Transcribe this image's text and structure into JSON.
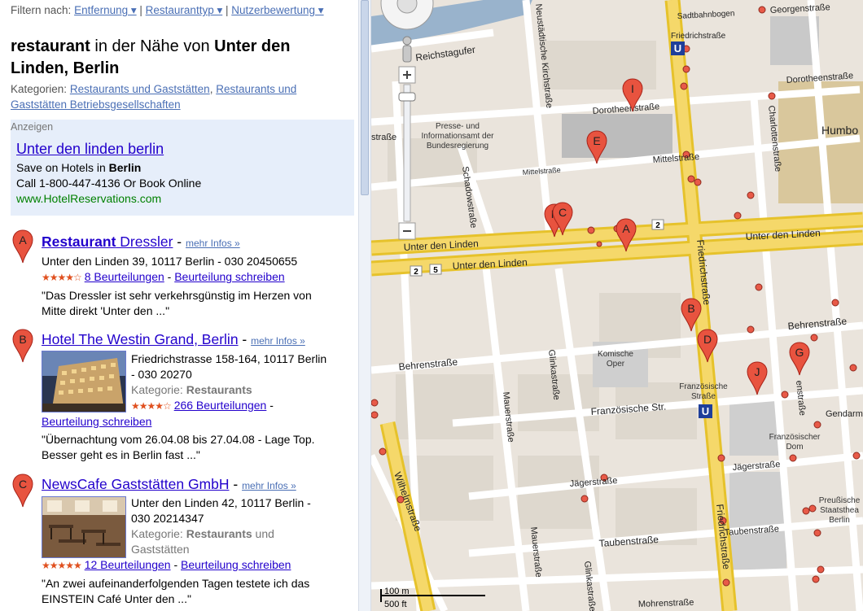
{
  "filter": {
    "label": "Filtern nach:",
    "items": [
      "Entfernung ▾",
      "Restauranttyp ▾",
      "Nutzerbewertung ▾"
    ]
  },
  "heading": {
    "term": "restaurant",
    "middle": " in der Nähe von ",
    "place": "Unter den Linden, Berlin"
  },
  "categories": {
    "label": "Kategorien:",
    "items": [
      "Restaurants und Gaststätten",
      "Restaurants und Gaststätten Betriebsgesellschaften"
    ]
  },
  "ads": {
    "label": "Anzeigen",
    "title": "Unter den linden berlin",
    "line1_prefix": "Save on Hotels in ",
    "line1_bold": "Berlin",
    "line2": "Call 1-800-447-4136 Or Book Online",
    "url": "www.HotelReservations.com"
  },
  "results": [
    {
      "letter": "A",
      "title_bold": "Restaurant",
      "title_rest": " Dressler",
      "more": "mehr Infos »",
      "address": "Unter den Linden 39, 10117 Berlin - 030 20450655",
      "stars": "★★★★☆",
      "reviews": "8 Beurteilungen",
      "write": "Beurteilung schreiben",
      "snippet1": "\"Das Dressler ist sehr verkehrsgünstig im Herzen von",
      "snippet2": "Mitte direkt 'Unter den ...\""
    },
    {
      "letter": "B",
      "title": "Hotel The Westin Grand, Berlin",
      "more": "mehr Infos »",
      "address1": "Friedrichstrasse 158-164, 10117 Berlin",
      "address2": "- 030 20270",
      "cat_label": "Kategorie:",
      "cat_value": "Restaurants",
      "stars": "★★★★☆",
      "reviews": "266 Beurteilungen",
      "write": "Beurteilung schreiben",
      "snippet1": "\"Übernachtung vom 26.04.08 bis 27.04.08 - Lage Top.",
      "snippet2": "Besser geht es in Berlin fast ...\""
    },
    {
      "letter": "C",
      "title": "NewsCafe Gaststätten GmbH",
      "more": "mehr Infos »",
      "address1": "Unter den Linden 42, 10117 Berlin -",
      "address2": "030 20214347",
      "cat_label": "Kategorie:",
      "cat_value": "Restaurants",
      "cat_extra": " und",
      "cat_line2": "Gaststätten",
      "stars": "★★★★★",
      "reviews": "12 Beurteilungen",
      "write": "Beurteilung schreiben",
      "snippet1": "\"An zwei aufeinanderfolgenden Tagen testete ich das",
      "snippet2": "EINSTEIN Café Unter den ...\""
    }
  ],
  "map": {
    "streets": {
      "unter_den_linden_1": "Unter den Linden",
      "unter_den_linden_2": "Unter den Linden",
      "unter_den_linden_3": "Unter den Linden",
      "friedrichstrasse": "Friedrichstraße",
      "friedrichstrasse_2": "Friedrichstraße",
      "friedrichstrasse_top": "Friedrichstraße",
      "behrenstrasse_left": "Behrenstraße",
      "behrenstrasse_right": "Behrenstraße",
      "reichstagufer": "Reichstagufer",
      "neustaedtische": "Neustädtische Kirchstraße",
      "dorotheenstrasse": "Dorotheenstraße",
      "dorotheenstrasse_right": "Dorotheenstraße",
      "mittelstrasse": "Mittelstraße",
      "mittelstrasse_2": "Mittelstraße",
      "schadowstrasse": "Schadowstraße",
      "charlottenstrasse": "Charlottenstraße",
      "glinkastrasse": "Glinkastraße",
      "glinkastrasse_2": "Glinkastraße",
      "mauerstrasse": "Mauerstraße",
      "mauerstrasse_2": "Mauerstraße",
      "wilhelmstrasse": "Wilhelmstraße",
      "franzoesische": "Französische Str.",
      "jaegerstrasse": "Jägerstraße",
      "jaegerstrasse_2": "Jägerstraße",
      "taubenstrasse": "Taubenstraße",
      "taubenstrasse_2": "Taubenstraße",
      "mohrenstrasse": "Mohrenstraße",
      "strasse_left": "straße",
      "sadtbahnbogen": "Sadtbahnbogen",
      "georgenstrasse": "Georgenstraße",
      "enstrasse": "enstraße",
      "gendarm": "Gendarm"
    },
    "places": {
      "presse1": "Presse- und",
      "presse2": "Informationsamt der",
      "presse3": "Bundesregierung",
      "komische1": "Komische",
      "komische2": "Oper",
      "franz_strasse1": "Französische",
      "franz_strasse2": "Straße",
      "franz_dom1": "Französischer",
      "franz_dom2": "Dom",
      "humbo": "Humbo",
      "preuss1": "Preußische",
      "preuss2": "Staatsthea",
      "preuss3": "Berlin"
    },
    "road_numbers": [
      "2",
      "2",
      "5"
    ],
    "scale": [
      "100 m",
      "500 ft"
    ],
    "markers": [
      "I",
      "E",
      "F",
      "C",
      "A",
      "B",
      "D",
      "J",
      "G"
    ],
    "transit": "U"
  }
}
